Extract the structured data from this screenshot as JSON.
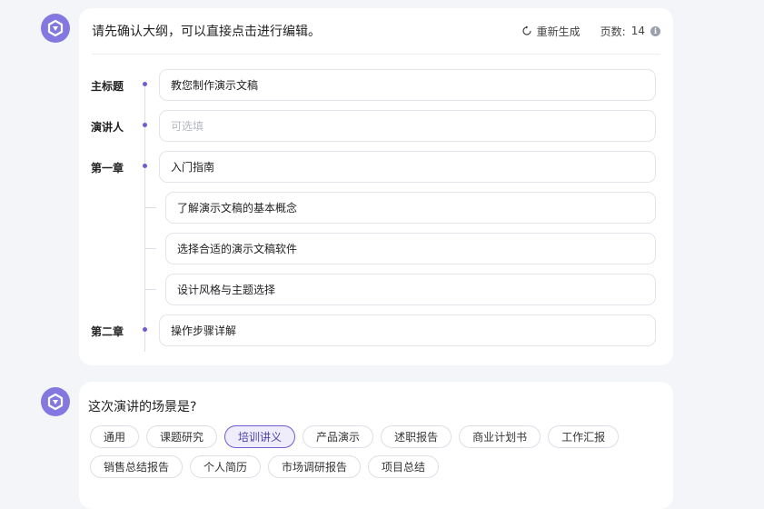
{
  "outline": {
    "title": "请先确认大纲，可以直接点击进行编辑。",
    "regenerate_label": "重新生成",
    "pages_label": "页数:",
    "pages_count": "14",
    "rows": {
      "main_title": {
        "label": "主标题",
        "value": "教您制作演示文稿"
      },
      "speaker": {
        "label": "演讲人",
        "placeholder": "可选填"
      },
      "chapter1": {
        "label": "第一章",
        "value": "入门指南",
        "subs": [
          "了解演示文稿的基本概念",
          "选择合适的演示文稿软件",
          "设计风格与主题选择"
        ]
      },
      "chapter2": {
        "label": "第二章",
        "value": "操作步骤详解"
      }
    }
  },
  "scene": {
    "question": "这次演讲的场景是?",
    "tags_row1": [
      "通用",
      "课题研究",
      "培训讲义",
      "产品演示",
      "述职报告",
      "商业计划书",
      "工作汇报"
    ],
    "tags_row2": [
      "销售总结报告",
      "个人简历",
      "市场调研报告",
      "项目总结"
    ],
    "selected": "培训讲义"
  },
  "colors": {
    "accent": "#6c5dd3",
    "avatar": "#8478e0"
  }
}
